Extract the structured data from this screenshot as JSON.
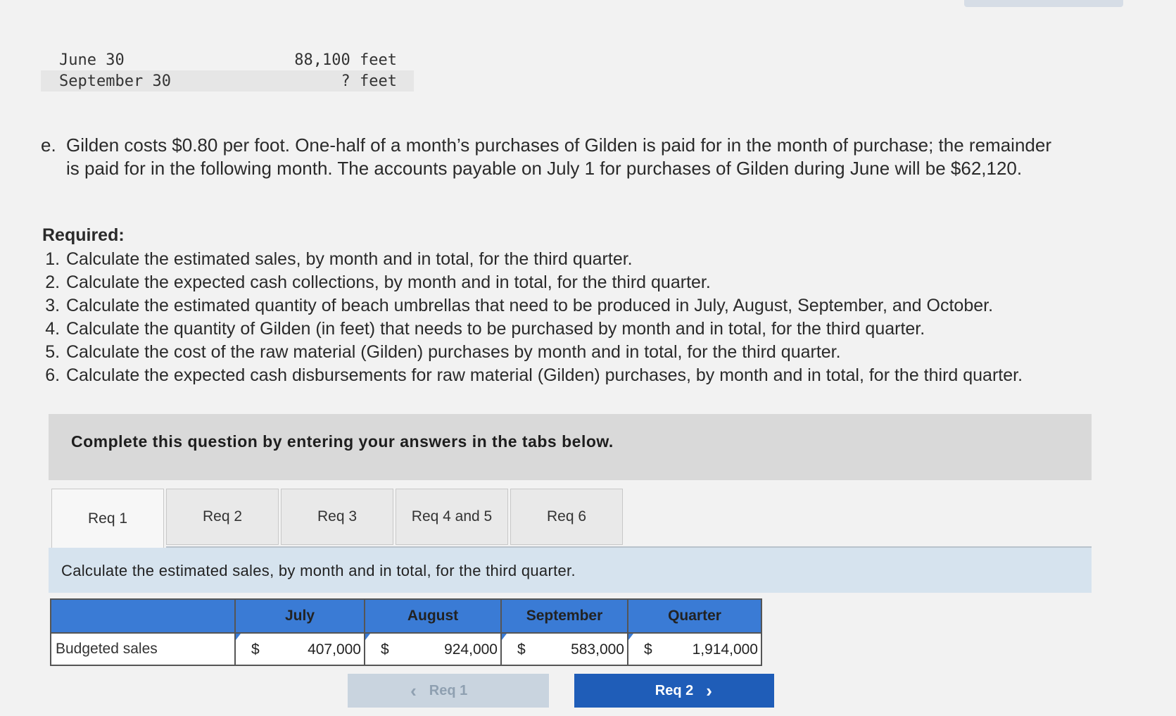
{
  "inventory_table": {
    "rows": [
      {
        "label": "June 30",
        "value": "88,100 feet"
      },
      {
        "label": "September 30",
        "value": "? feet"
      }
    ]
  },
  "item_e": {
    "marker": "e.",
    "line1": "Gilden costs $0.80 per foot. One-half of a month’s purchases of Gilden is paid for in the month of purchase; the remainder",
    "line2": "is paid for in the following month. The accounts payable on July 1 for purchases of Gilden during June will be $62,120."
  },
  "required": {
    "title": "Required:",
    "items": [
      "Calculate the estimated sales, by month and in total, for the third quarter.",
      "Calculate the expected cash collections, by month and in total, for the third quarter.",
      "Calculate the estimated quantity of beach umbrellas that need to be produced in July, August, September, and October.",
      "Calculate the quantity of Gilden (in feet) that needs to be purchased by month and in total, for the third quarter.",
      "Calculate the cost of the raw material (Gilden) purchases by month and in total, for the third quarter.",
      "Calculate the expected cash disbursements for raw material (Gilden) purchases, by month and in total, for the third quarter."
    ]
  },
  "complete_prompt": "Complete this question by entering your answers in the tabs below.",
  "tabs": [
    {
      "label": "Req 1",
      "active": true
    },
    {
      "label": "Req 2",
      "active": false
    },
    {
      "label": "Req 3",
      "active": false
    },
    {
      "label": "Req 4 and 5",
      "active": false
    },
    {
      "label": "Req 6",
      "active": false
    }
  ],
  "instruction": "Calculate the estimated sales, by month and in total, for the third quarter.",
  "sales_table": {
    "headers": [
      "",
      "July",
      "August",
      "September",
      "Quarter"
    ],
    "row_label": "Budgeted sales",
    "currency": "$",
    "values": [
      "407,000",
      "924,000",
      "583,000",
      "1,914,000"
    ]
  },
  "nav": {
    "prev_label": "Req 1",
    "next_label": "Req 2"
  },
  "colors": {
    "header_blue": "#3a7bd5",
    "next_button": "#1f5db8",
    "instruction_bg": "#d6e3ee"
  }
}
